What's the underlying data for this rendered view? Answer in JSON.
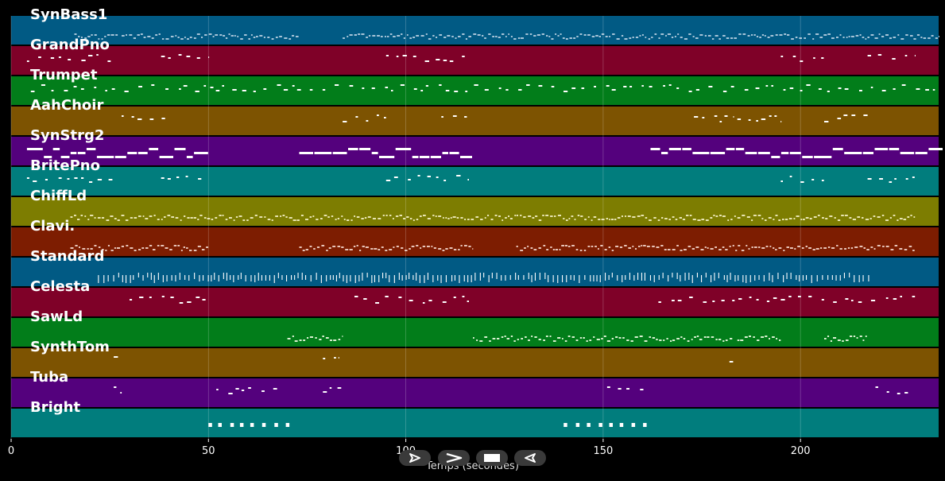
{
  "chart_data": {
    "type": "piano-roll",
    "xlabel": "Temps (secondes)",
    "xlim": [
      0,
      235
    ],
    "x_ticks": [
      0,
      50,
      100,
      150,
      200
    ],
    "grid": true,
    "tracks": [
      {
        "name": "SynBass1",
        "color": "#015a84",
        "note_color": "#a7c4d8",
        "segments": [
          [
            16,
            27
          ],
          [
            28,
            73
          ],
          [
            84,
            235
          ]
        ],
        "style": "dense"
      },
      {
        "name": "GrandPno",
        "color": "#7f0128",
        "note_color": "#ffffff",
        "segments": [
          [
            4,
            26
          ],
          [
            38,
            50
          ],
          [
            95,
            116
          ],
          [
            195,
            206
          ],
          [
            217,
            229
          ]
        ],
        "style": "sparse"
      },
      {
        "name": "Trumpet",
        "color": "#027d1a",
        "note_color": "#ffffff",
        "segments": [
          [
            5,
            235
          ]
        ],
        "style": "sparse"
      },
      {
        "name": "AahChoir",
        "color": "#7d5301",
        "note_color": "#ffffff",
        "segments": [
          [
            28,
            39
          ],
          [
            84,
            95
          ],
          [
            109,
            117
          ],
          [
            173,
            183
          ],
          [
            184,
            195
          ],
          [
            206,
            217
          ]
        ],
        "style": "sparse"
      },
      {
        "name": "SynStrg2",
        "color": "#54017d",
        "note_color": "#ffffff",
        "segments": [
          [
            4,
            50
          ],
          [
            73,
            117
          ],
          [
            162,
            236
          ]
        ],
        "style": "thick"
      },
      {
        "name": "BritePno",
        "color": "#017d7d",
        "note_color": "#ffffff",
        "segments": [
          [
            4,
            26
          ],
          [
            38,
            50
          ],
          [
            95,
            116
          ],
          [
            195,
            206
          ],
          [
            217,
            229
          ]
        ],
        "style": "sparse"
      },
      {
        "name": "ChiffLd",
        "color": "#7d7d01",
        "note_color": "#e8e4b0",
        "segments": [
          [
            15,
            229
          ]
        ],
        "style": "dense"
      },
      {
        "name": "Clavi.",
        "color": "#7d1d01",
        "note_color": "#e8c4b8",
        "segments": [
          [
            15,
            50
          ],
          [
            73,
            117
          ],
          [
            128,
            229
          ]
        ],
        "style": "dense"
      },
      {
        "name": "Standard",
        "color": "#015a84",
        "note_color": "#ffffff",
        "segments": [
          [
            22,
            218
          ]
        ],
        "style": "ticks"
      },
      {
        "name": "Celesta",
        "color": "#7f0128",
        "note_color": "#ffffff",
        "segments": [
          [
            30,
            50
          ],
          [
            87,
            116
          ],
          [
            164,
            229
          ]
        ],
        "style": "sparse"
      },
      {
        "name": "SawLd",
        "color": "#027d1a",
        "note_color": "#d8f0d0",
        "segments": [
          [
            70,
            84
          ],
          [
            117,
            183
          ],
          [
            184,
            195
          ],
          [
            206,
            217
          ]
        ],
        "style": "dense"
      },
      {
        "name": "SynthTom",
        "color": "#7d5301",
        "note_color": "#ffffff",
        "segments": [
          [
            26,
            28
          ],
          [
            79,
            83
          ],
          [
            182,
            184
          ]
        ],
        "style": "sparse"
      },
      {
        "name": "Tuba",
        "color": "#54017d",
        "note_color": "#ffffff",
        "segments": [
          [
            26,
            28
          ],
          [
            52,
            70
          ],
          [
            79,
            84
          ],
          [
            151,
            161
          ],
          [
            219,
            229
          ]
        ],
        "style": "sparse"
      },
      {
        "name": "Bright",
        "color": "#017d7d",
        "note_color": "#ffffff",
        "segments": [
          [
            50,
            71
          ],
          [
            140,
            162
          ]
        ],
        "style": "blocks"
      }
    ]
  },
  "controls": [
    {
      "name": "play",
      "icon": "play-outline-icon"
    },
    {
      "name": "forward",
      "icon": "chevron-right-icon"
    },
    {
      "name": "stop",
      "icon": "stop-icon"
    },
    {
      "name": "back",
      "icon": "play-reverse-icon"
    }
  ]
}
